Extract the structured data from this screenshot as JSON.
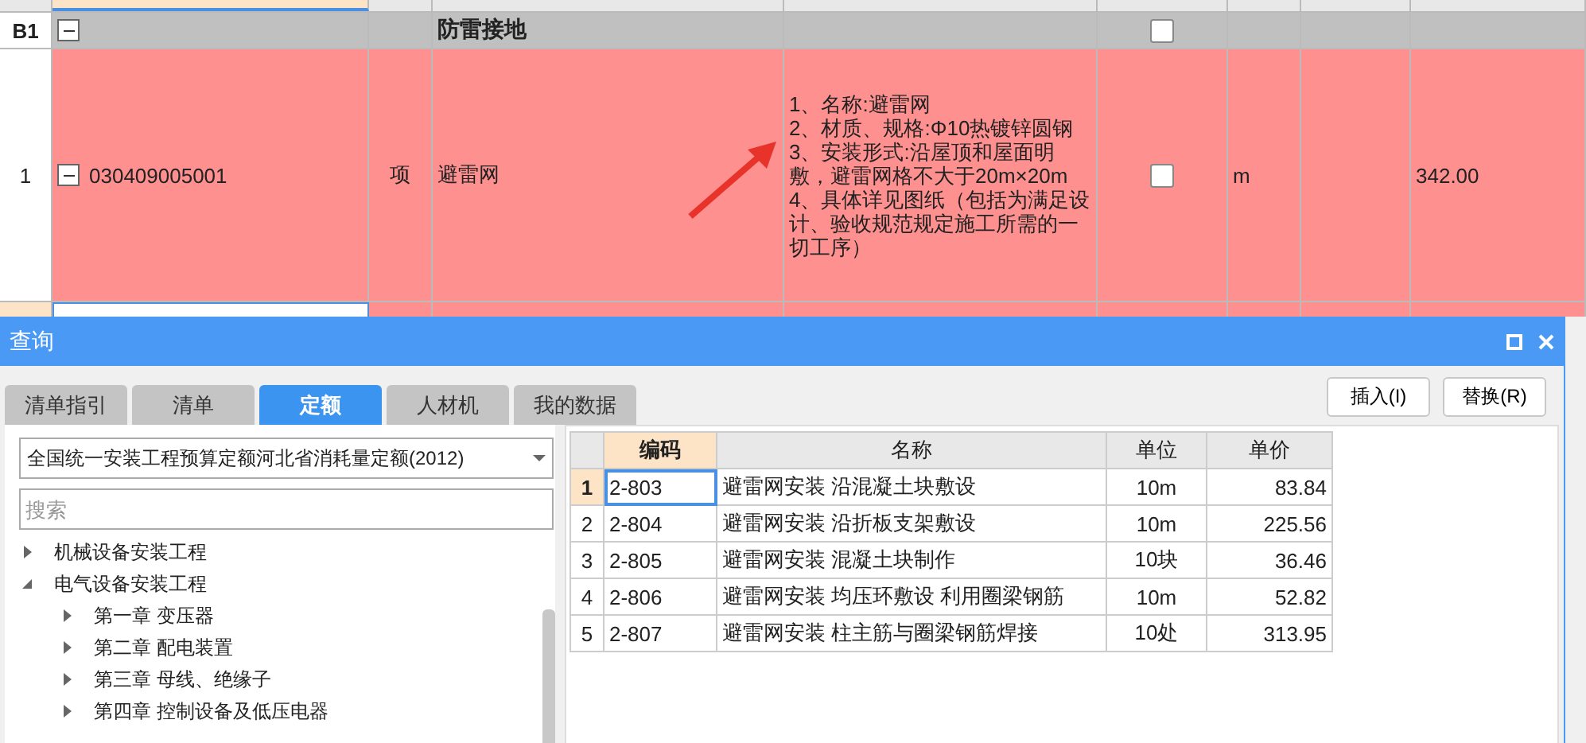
{
  "sheet": {
    "group": {
      "id": "B1",
      "expanded": true,
      "name": "防雷接地",
      "checked": false
    },
    "items": [
      {
        "index": "1",
        "code": "030409005001",
        "expanded": true,
        "type": "项",
        "name": "避雷网",
        "features": [
          "1、名称:避雷网",
          "2、材质、规格:Φ10热镀锌圆钢",
          "3、安装形式:沿屋顶和屋面明敷，避雷网格不大于20m×20m",
          "4、具体详见图纸（包括为满足设计、验收规范规定施工所需的一切工序）"
        ],
        "checked": false,
        "unit": "m",
        "quantity": "342.00"
      }
    ]
  },
  "dialog": {
    "title": "查询",
    "tabs": [
      {
        "label": "清单指引",
        "selected": false
      },
      {
        "label": "清单",
        "selected": false
      },
      {
        "label": "定额",
        "selected": true
      },
      {
        "label": "人材机",
        "selected": false
      },
      {
        "label": "我的数据",
        "selected": false
      }
    ],
    "library": {
      "value": "全国统一安装工程预算定额河北省消耗量定额(2012)"
    },
    "search": {
      "placeholder": "搜索"
    },
    "tree": [
      {
        "label": "机械设备安装工程",
        "expanded": false
      },
      {
        "label": "电气设备安装工程",
        "expanded": true,
        "children": [
          {
            "label": "第一章  变压器",
            "expanded": false
          },
          {
            "label": "第二章  配电装置",
            "expanded": false
          },
          {
            "label": "第三章  母线、绝缘子",
            "expanded": false
          },
          {
            "label": "第四章  控制设备及低压电器",
            "expanded": false
          }
        ]
      }
    ],
    "buttons": [
      "插入(I)",
      "替换(R)"
    ],
    "table": {
      "columns": [
        "编码",
        "名称",
        "单位",
        "单价"
      ],
      "rows": [
        {
          "index": "1",
          "code": "2-803",
          "name": "避雷网安装  沿混凝土块敷设",
          "unit": "10m",
          "price": "83.84",
          "selected": true
        },
        {
          "index": "2",
          "code": "2-804",
          "name": "避雷网安装  沿折板支架敷设",
          "unit": "10m",
          "price": "225.56",
          "selected": false
        },
        {
          "index": "3",
          "code": "2-805",
          "name": "避雷网安装  混凝土块制作",
          "unit": "10块",
          "price": "36.46",
          "selected": false
        },
        {
          "index": "4",
          "code": "2-806",
          "name": "避雷网安装  均压环敷设  利用圈梁钢筋",
          "unit": "10m",
          "price": "52.82",
          "selected": false
        },
        {
          "index": "5",
          "code": "2-807",
          "name": "避雷网安装  柱主筋与圈梁钢筋焊接",
          "unit": "10处",
          "price": "313.95",
          "selected": false
        }
      ]
    }
  }
}
